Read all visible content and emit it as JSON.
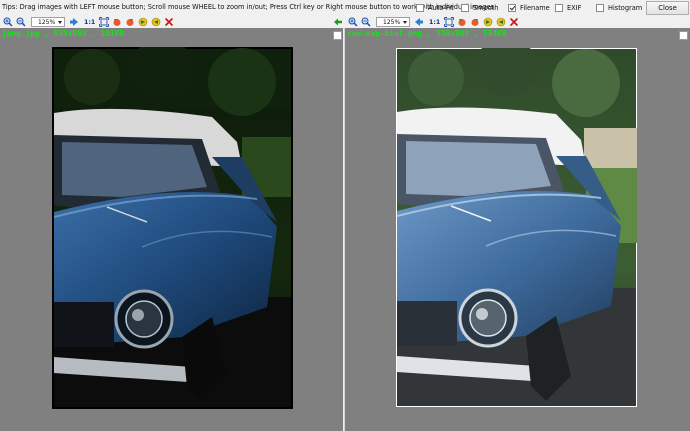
{
  "tips_text": "Tips: Drag images with LEFT mouse button; Scroll mouse WHEEL to zoom in/out; Press Ctrl key or Right mouse button to work with individual images.",
  "options": [
    {
      "key": "autofit",
      "label": "Auto-Fit",
      "checked": false
    },
    {
      "key": "smooth",
      "label": "Smooth",
      "checked": false
    },
    {
      "key": "filename",
      "label": "Filename",
      "checked": true
    },
    {
      "key": "exif",
      "label": "EXIF",
      "checked": false
    },
    {
      "key": "histogram",
      "label": "Histogram",
      "checked": false
    }
  ],
  "close_label": "Close",
  "left": {
    "zoom": "125%",
    "ratio_label": "1:1",
    "caption": "jpeg.jpg , 539x803 , 281KB",
    "icons": [
      "zoom-in-icon",
      "zoom-out-icon",
      "next-image-icon",
      "fit-to-window-icon",
      "rotate-left-icon",
      "rotate-right-icon",
      "next-icon",
      "previous-icon",
      "delete-icon"
    ]
  },
  "right": {
    "zoom": "125%",
    "ratio_label": "1:1",
    "caption": "raw-exp-hist.png , 539x803 , 584KB",
    "icons": [
      "zoom-in-icon",
      "zoom-out-icon",
      "previous-image-icon",
      "fit-to-window-icon",
      "rotate-left-icon",
      "rotate-right-icon",
      "next-icon",
      "previous-icon",
      "delete-icon"
    ]
  },
  "colors": {
    "caption_green": "#1fdc1f",
    "pane_gray": "#808080",
    "car_blue": "#2d5a8c",
    "delete_red": "#cc1111"
  }
}
